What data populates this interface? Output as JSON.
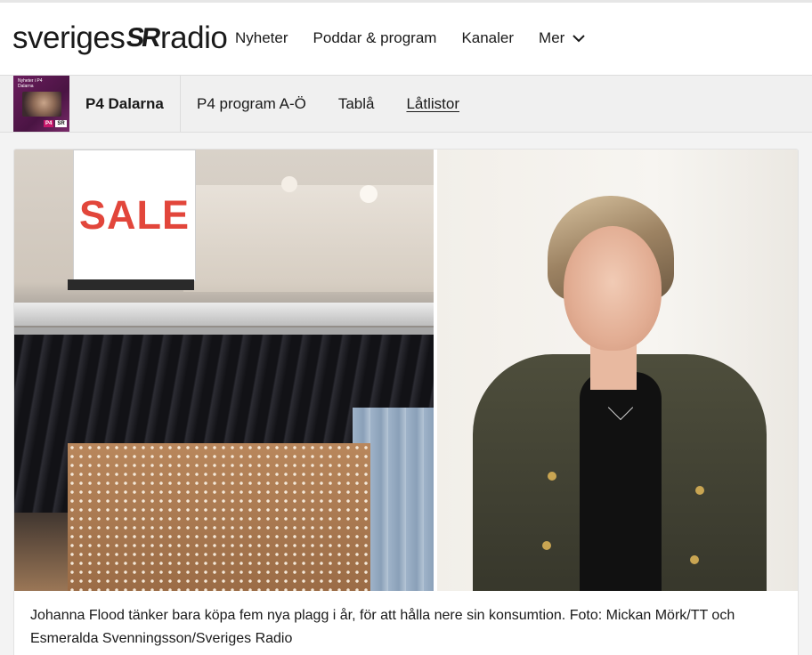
{
  "header": {
    "logo_left": "sveriges",
    "logo_mark": "SR",
    "logo_right": "radio",
    "nav": [
      {
        "label": "Nyheter"
      },
      {
        "label": "Poddar & program"
      },
      {
        "label": "Kanaler"
      },
      {
        "label": "Mer",
        "icon": "chevron-down-icon"
      }
    ]
  },
  "channel": {
    "thumb_line1": "Nyheter i P4",
    "thumb_line2": "Dalarna",
    "thumb_badge_p4": "P4",
    "thumb_badge_sr": "SR",
    "name": "P4 Dalarna",
    "subnav": [
      {
        "label": "P4 program A-Ö",
        "active": false
      },
      {
        "label": "Tablå",
        "active": false
      },
      {
        "label": "Låtlistor",
        "active": true
      }
    ]
  },
  "article": {
    "sale_sign_text": "SALE",
    "caption": "Johanna Flood tänker bara köpa fem nya plagg i år, för att hålla nere sin konsumtion. Foto: Mickan Mörk/TT och Esmeralda Svenningsson/Sveriges Radio"
  },
  "colors": {
    "sale_red": "#e2463b",
    "channel_purple": "#6b1d5e",
    "p4_pink": "#c8176b"
  }
}
